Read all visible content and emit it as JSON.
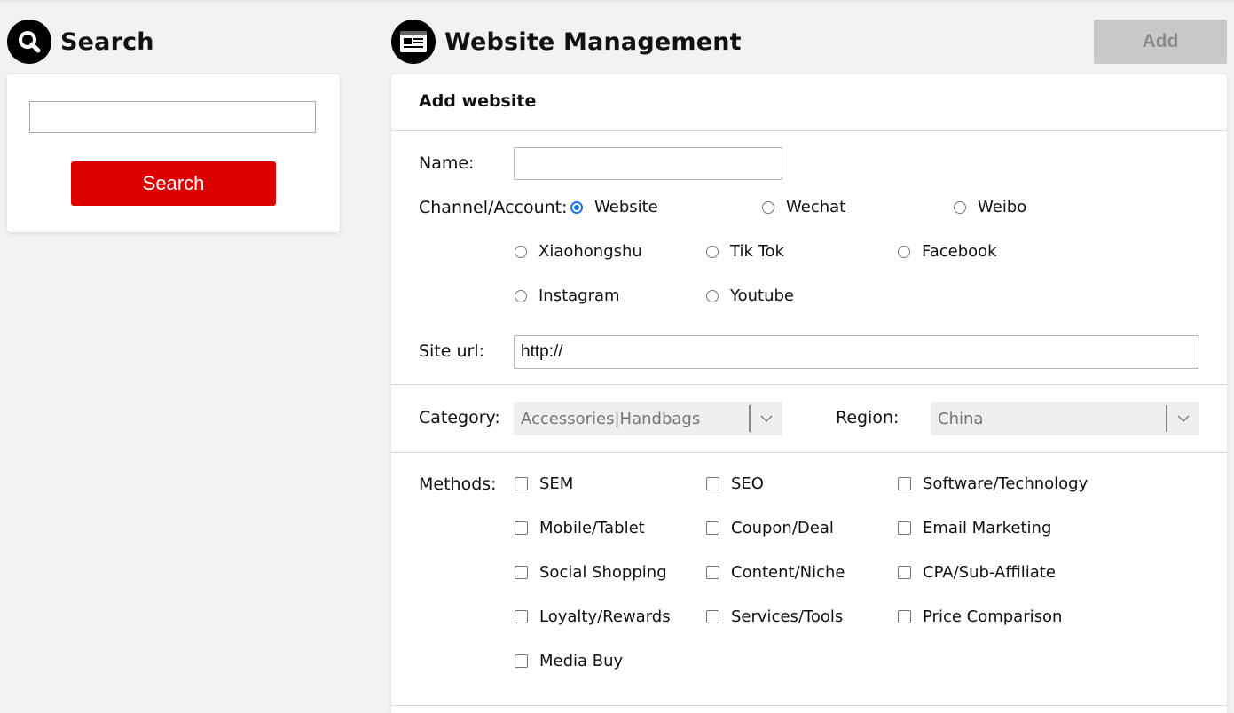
{
  "search_panel": {
    "title": "Search",
    "input_value": "",
    "button_label": "Search",
    "icon": "search-icon"
  },
  "management": {
    "title": "Website Management",
    "icon": "website-icon",
    "add_button": "Add"
  },
  "form": {
    "title": "Add website",
    "name": {
      "label": "Name:",
      "value": ""
    },
    "channel": {
      "label": "Channel/Account:",
      "options": [
        "Website",
        "Wechat",
        "Weibo",
        "Xiaohongshu",
        "Tik Tok",
        "Facebook",
        "Instagram",
        "Youtube"
      ],
      "selected": "Website"
    },
    "site_url": {
      "label": "Site url:",
      "value": "http://"
    },
    "category": {
      "label": "Category:",
      "value": "Accessories|Handbags"
    },
    "region": {
      "label": "Region:",
      "value": "China"
    },
    "methods": {
      "label": "Methods:",
      "options": [
        "SEM",
        "SEO",
        "Software/Technology",
        "Mobile/Tablet",
        "Coupon/Deal",
        "Email Marketing",
        "Social Shopping",
        "Content/Niche",
        "CPA/Sub-Affiliate",
        "Loyalty/Rewards",
        "Services/Tools",
        "Price Comparison",
        "Media Buy"
      ]
    }
  },
  "colors": {
    "search_button": "#dd0000",
    "add_button_disabled": "#c9c9c9",
    "radio_selected": "#1a73e8",
    "page_background": "#f2f2f2"
  }
}
